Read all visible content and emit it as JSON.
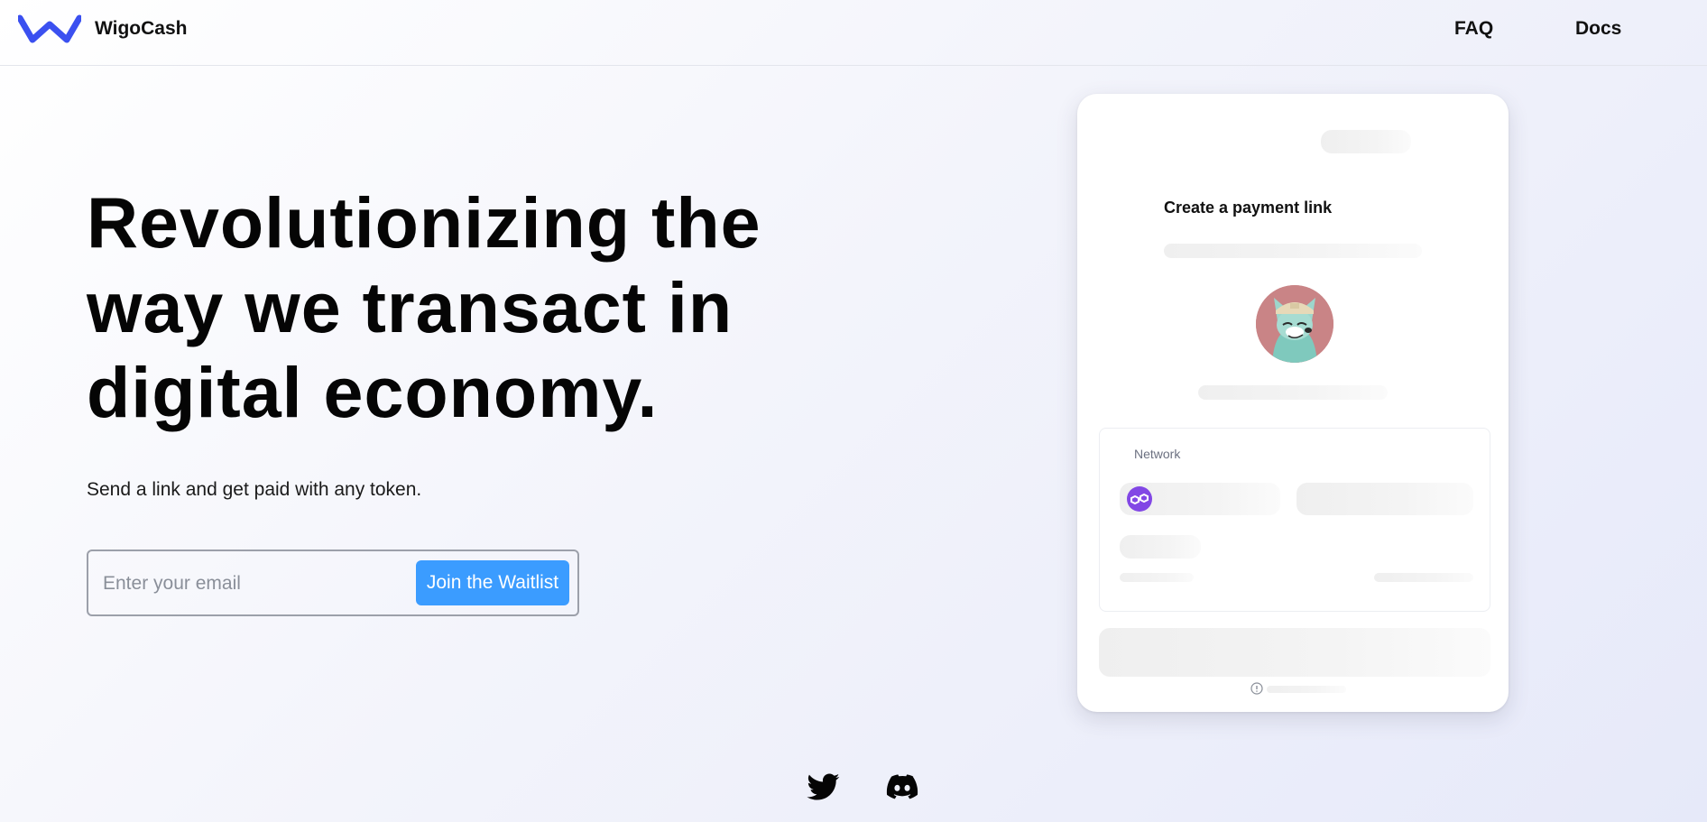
{
  "header": {
    "brand": "WigoCash",
    "nav": {
      "faq": "FAQ",
      "docs": "Docs"
    },
    "logo_color": "#3b50f0"
  },
  "hero": {
    "title_lines": [
      "Revolutionizing the",
      "way we transact in",
      "digital economy."
    ],
    "subtitle": "Send a link and get paid with any token.",
    "email_placeholder": "Enter your email",
    "join_label": "Join the Waitlist",
    "button_color": "#3b9cff"
  },
  "card": {
    "title": "Create a payment link",
    "network_label": "Network",
    "network_icon": "polygon-icon",
    "network_icon_color": "#8247e5",
    "avatar": "wolf-avatar"
  },
  "social": {
    "icons": [
      "twitter-icon",
      "discord-icon"
    ]
  }
}
